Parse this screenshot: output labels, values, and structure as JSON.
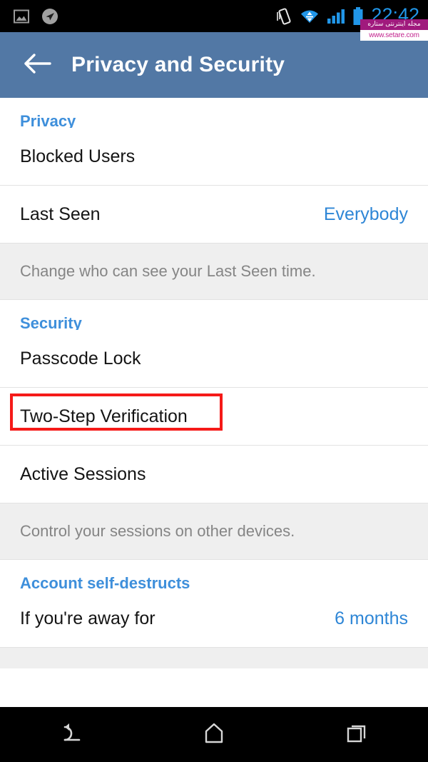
{
  "status_bar": {
    "time": "22:42",
    "time_color": "#2196E8",
    "left_icons": [
      {
        "name": "screenshot-image-icon"
      },
      {
        "name": "location-arrow-icon"
      }
    ],
    "right_icons": [
      {
        "name": "vibrate-icon"
      },
      {
        "name": "wifi-icon"
      },
      {
        "name": "cellular-signal-icon"
      },
      {
        "name": "battery-icon"
      }
    ]
  },
  "watermark": {
    "banner_text": "مجله اینترنتی ستاره",
    "url_text": "www.setare.com",
    "banner_color": "#A01A7D",
    "url_color": "#C3248E"
  },
  "app_bar": {
    "back_icon": "arrow-left-icon",
    "title": "Privacy and Security",
    "background": "#5278A5"
  },
  "sections": [
    {
      "header": "Privacy",
      "header_color": "#3E8FDB",
      "rows": [
        {
          "title": "Blocked Users",
          "value": ""
        },
        {
          "title": "Last Seen",
          "value": "Everybody"
        }
      ],
      "note": "Change who can see your Last Seen time."
    },
    {
      "header": "Security",
      "header_color": "#3E8FDB",
      "rows": [
        {
          "title": "Passcode Lock",
          "value": ""
        },
        {
          "title": "Two-Step Verification",
          "value": "",
          "highlighted": true
        },
        {
          "title": "Active Sessions",
          "value": ""
        }
      ],
      "note": "Control your sessions on other devices."
    },
    {
      "header": "Account self-destructs",
      "header_color": "#3E8FDB",
      "rows": [
        {
          "title": "If you're away for",
          "value": "6 months"
        }
      ],
      "note": ""
    }
  ],
  "highlight": {
    "color": "#F51A18",
    "target": "Two-Step Verification"
  },
  "nav_bar": {
    "buttons": [
      {
        "name": "back-nav-button",
        "icon": "back-arrow-icon"
      },
      {
        "name": "home-nav-button",
        "icon": "home-icon"
      },
      {
        "name": "recents-nav-button",
        "icon": "recents-squares-icon"
      }
    ]
  }
}
